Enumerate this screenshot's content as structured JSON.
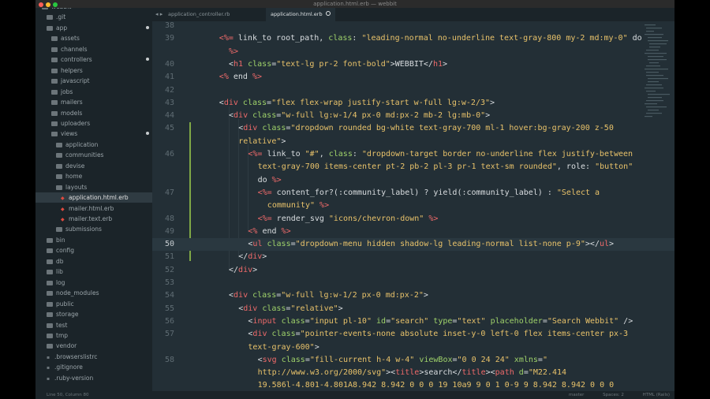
{
  "window": {
    "title": "application.html.erb — webbit"
  },
  "tabs": [
    {
      "label": "application_controller.rb",
      "active": false
    },
    {
      "label": "application.html.erb",
      "active": true
    }
  ],
  "sidebar": {
    "items": [
      {
        "label": "webbit",
        "type": "folder",
        "depth": 0
      },
      {
        "label": ".git",
        "type": "folder",
        "depth": 1
      },
      {
        "label": "app",
        "type": "folder",
        "depth": 1,
        "modified": true
      },
      {
        "label": "assets",
        "type": "folder",
        "depth": 2
      },
      {
        "label": "channels",
        "type": "folder",
        "depth": 2
      },
      {
        "label": "controllers",
        "type": "folder",
        "depth": 2,
        "modified": true
      },
      {
        "label": "helpers",
        "type": "folder",
        "depth": 2
      },
      {
        "label": "javascript",
        "type": "folder",
        "depth": 2
      },
      {
        "label": "jobs",
        "type": "folder",
        "depth": 2
      },
      {
        "label": "mailers",
        "type": "folder",
        "depth": 2
      },
      {
        "label": "models",
        "type": "folder",
        "depth": 2
      },
      {
        "label": "uploaders",
        "type": "folder",
        "depth": 2
      },
      {
        "label": "views",
        "type": "folder",
        "depth": 2,
        "modified": true
      },
      {
        "label": "application",
        "type": "folder",
        "depth": 3
      },
      {
        "label": "communities",
        "type": "folder",
        "depth": 3
      },
      {
        "label": "devise",
        "type": "folder",
        "depth": 3
      },
      {
        "label": "home",
        "type": "folder",
        "depth": 3
      },
      {
        "label": "layouts",
        "type": "folder",
        "depth": 3
      },
      {
        "label": "application.html.erb",
        "type": "file",
        "depth": 4,
        "selected": true
      },
      {
        "label": "mailer.html.erb",
        "type": "file",
        "depth": 4
      },
      {
        "label": "mailer.text.erb",
        "type": "file",
        "depth": 4
      },
      {
        "label": "submissions",
        "type": "folder",
        "depth": 3
      },
      {
        "label": "bin",
        "type": "folder",
        "depth": 1
      },
      {
        "label": "config",
        "type": "folder",
        "depth": 1
      },
      {
        "label": "db",
        "type": "folder",
        "depth": 1
      },
      {
        "label": "lib",
        "type": "folder",
        "depth": 1
      },
      {
        "label": "log",
        "type": "folder",
        "depth": 1
      },
      {
        "label": "node_modules",
        "type": "folder",
        "depth": 1
      },
      {
        "label": "public",
        "type": "folder",
        "depth": 1
      },
      {
        "label": "storage",
        "type": "folder",
        "depth": 1
      },
      {
        "label": "test",
        "type": "folder",
        "depth": 1
      },
      {
        "label": "tmp",
        "type": "folder",
        "depth": 1
      },
      {
        "label": "vendor",
        "type": "folder",
        "depth": 1
      },
      {
        "label": ".browserslistrc",
        "type": "dotfile",
        "depth": 1
      },
      {
        "label": ".gitignore",
        "type": "dotfile",
        "depth": 1
      },
      {
        "label": ".ruby-version",
        "type": "dotfile",
        "depth": 1
      }
    ]
  },
  "editor": {
    "current_line": "50",
    "lines": [
      {
        "num": "38",
        "indent": 0,
        "parts": []
      },
      {
        "num": "39",
        "indent": 4,
        "parts": [
          [
            "<%=",
            "e"
          ],
          [
            " link_to root_path, ",
            "p"
          ],
          [
            "class",
            "a"
          ],
          [
            ": ",
            "p"
          ],
          [
            "\"leading-normal no-underline text-gray-800 my-2 md:my-0\"",
            "s"
          ],
          [
            " do",
            "p"
          ]
        ]
      },
      {
        "num": "",
        "indent": 5,
        "parts": [
          [
            "%>",
            "e"
          ]
        ]
      },
      {
        "num": "40",
        "indent": 5,
        "parts": [
          [
            "<",
            "p"
          ],
          [
            "h1",
            "t"
          ],
          [
            " ",
            "p"
          ],
          [
            "class",
            "a"
          ],
          [
            "=",
            "p"
          ],
          [
            "\"text-lg pr-2 font-bold\"",
            "s"
          ],
          [
            ">WEBBIT</",
            "p"
          ],
          [
            "h1",
            "t"
          ],
          [
            ">",
            "p"
          ]
        ]
      },
      {
        "num": "41",
        "indent": 4,
        "parts": [
          [
            "<%",
            "e"
          ],
          [
            " end ",
            "p"
          ],
          [
            "%>",
            "e"
          ]
        ]
      },
      {
        "num": "42",
        "indent": 0,
        "parts": []
      },
      {
        "num": "43",
        "indent": 4,
        "parts": [
          [
            "<",
            "p"
          ],
          [
            "div",
            "t"
          ],
          [
            " ",
            "p"
          ],
          [
            "class",
            "a"
          ],
          [
            "=",
            "p"
          ],
          [
            "\"flex flex-wrap justify-start w-full lg:w-2/3\"",
            "s"
          ],
          [
            ">",
            "p"
          ]
        ]
      },
      {
        "num": "44",
        "indent": 5,
        "parts": [
          [
            "<",
            "p"
          ],
          [
            "div",
            "t"
          ],
          [
            " ",
            "p"
          ],
          [
            "class",
            "a"
          ],
          [
            "=",
            "p"
          ],
          [
            "\"w-full lg:w-1/4 px-0 md:px-2 mb-2 lg:mb-0\"",
            "s"
          ],
          [
            ">",
            "p"
          ]
        ]
      },
      {
        "num": "45",
        "indent": 6,
        "parts": [
          [
            "<",
            "p"
          ],
          [
            "div",
            "t"
          ],
          [
            " ",
            "p"
          ],
          [
            "class",
            "a"
          ],
          [
            "=",
            "p"
          ],
          [
            "\"dropdown rounded bg-white text-gray-700 ml-1 hover:bg-gray-200 z-50",
            "s"
          ]
        ]
      },
      {
        "num": "",
        "indent": 6,
        "parts": [
          [
            "relative\"",
            "s"
          ],
          [
            ">",
            "p"
          ]
        ]
      },
      {
        "num": "46",
        "indent": 7,
        "parts": [
          [
            "<%=",
            "e"
          ],
          [
            " link_to ",
            "p"
          ],
          [
            "\"#\"",
            "s"
          ],
          [
            ", ",
            "p"
          ],
          [
            "class",
            "a"
          ],
          [
            ": ",
            "p"
          ],
          [
            "\"dropdown-target border no-underline flex justify-between",
            "s"
          ]
        ]
      },
      {
        "num": "",
        "indent": 8,
        "parts": [
          [
            "text-gray-700 items-center pt-2 pb-2 pl-3 pr-1 text-sm rounded\"",
            "s"
          ],
          [
            ", role: ",
            "p"
          ],
          [
            "\"button\"",
            "s"
          ]
        ]
      },
      {
        "num": "",
        "indent": 8,
        "parts": [
          [
            "do ",
            "p"
          ],
          [
            "%>",
            "e"
          ]
        ]
      },
      {
        "num": "47",
        "indent": 8,
        "parts": [
          [
            "<%=",
            "e"
          ],
          [
            " content_for?(:community_label) ? yield(:community_label) : ",
            "p"
          ],
          [
            "\"Select a",
            "s"
          ]
        ]
      },
      {
        "num": "",
        "indent": 9,
        "parts": [
          [
            "community\"",
            "s"
          ],
          [
            " ",
            "p"
          ],
          [
            "%>",
            "e"
          ]
        ]
      },
      {
        "num": "48",
        "indent": 8,
        "parts": [
          [
            "<%=",
            "e"
          ],
          [
            " render_svg ",
            "p"
          ],
          [
            "\"icons/chevron-down\"",
            "s"
          ],
          [
            " ",
            "p"
          ],
          [
            "%>",
            "e"
          ]
        ]
      },
      {
        "num": "49",
        "indent": 7,
        "parts": [
          [
            "<%",
            "e"
          ],
          [
            " end ",
            "p"
          ],
          [
            "%>",
            "e"
          ]
        ]
      },
      {
        "num": "50",
        "indent": 7,
        "parts": [
          [
            "<",
            "p"
          ],
          [
            "ul",
            "t"
          ],
          [
            " ",
            "p"
          ],
          [
            "class",
            "a"
          ],
          [
            "=",
            "p"
          ],
          [
            "\"dropdown-menu hidden shadow-lg leading-normal list-none p-9\"",
            "s"
          ],
          [
            "></",
            "p"
          ],
          [
            "ul",
            "t"
          ],
          [
            ">",
            "p"
          ]
        ]
      },
      {
        "num": "51",
        "indent": 6,
        "parts": [
          [
            "</",
            "p"
          ],
          [
            "div",
            "t"
          ],
          [
            ">",
            "p"
          ]
        ]
      },
      {
        "num": "52",
        "indent": 5,
        "parts": [
          [
            "</",
            "p"
          ],
          [
            "div",
            "t"
          ],
          [
            ">",
            "p"
          ]
        ]
      },
      {
        "num": "53",
        "indent": 0,
        "parts": []
      },
      {
        "num": "54",
        "indent": 5,
        "parts": [
          [
            "<",
            "p"
          ],
          [
            "div",
            "t"
          ],
          [
            " ",
            "p"
          ],
          [
            "class",
            "a"
          ],
          [
            "=",
            "p"
          ],
          [
            "\"w-full lg:w-1/2 px-0 md:px-2\"",
            "s"
          ],
          [
            ">",
            "p"
          ]
        ]
      },
      {
        "num": "55",
        "indent": 6,
        "parts": [
          [
            "<",
            "p"
          ],
          [
            "div",
            "t"
          ],
          [
            " ",
            "p"
          ],
          [
            "class",
            "a"
          ],
          [
            "=",
            "p"
          ],
          [
            "\"relative\"",
            "s"
          ],
          [
            ">",
            "p"
          ]
        ]
      },
      {
        "num": "56",
        "indent": 7,
        "parts": [
          [
            "<",
            "p"
          ],
          [
            "input",
            "t"
          ],
          [
            " ",
            "p"
          ],
          [
            "class",
            "a"
          ],
          [
            "=",
            "p"
          ],
          [
            "\"input pl-10\"",
            "s"
          ],
          [
            " ",
            "p"
          ],
          [
            "id",
            "a"
          ],
          [
            "=",
            "p"
          ],
          [
            "\"search\"",
            "s"
          ],
          [
            " ",
            "p"
          ],
          [
            "type",
            "a"
          ],
          [
            "=",
            "p"
          ],
          [
            "\"text\"",
            "s"
          ],
          [
            " ",
            "p"
          ],
          [
            "placeholder",
            "a"
          ],
          [
            "=",
            "p"
          ],
          [
            "\"Search Webbit\"",
            "s"
          ],
          [
            " />",
            "p"
          ]
        ]
      },
      {
        "num": "57",
        "indent": 7,
        "parts": [
          [
            "<",
            "p"
          ],
          [
            "div",
            "t"
          ],
          [
            " ",
            "p"
          ],
          [
            "class",
            "a"
          ],
          [
            "=",
            "p"
          ],
          [
            "\"pointer-events-none absolute inset-y-0 left-0 flex items-center px-3",
            "s"
          ]
        ]
      },
      {
        "num": "",
        "indent": 7,
        "parts": [
          [
            "text-gray-600\"",
            "s"
          ],
          [
            ">",
            "p"
          ]
        ]
      },
      {
        "num": "58",
        "indent": 8,
        "parts": [
          [
            "<",
            "p"
          ],
          [
            "svg",
            "t"
          ],
          [
            " ",
            "p"
          ],
          [
            "class",
            "a"
          ],
          [
            "=",
            "p"
          ],
          [
            "\"fill-current h-4 w-4\"",
            "s"
          ],
          [
            " ",
            "p"
          ],
          [
            "viewBox",
            "a"
          ],
          [
            "=",
            "p"
          ],
          [
            "\"0 0 24 24\"",
            "s"
          ],
          [
            " ",
            "p"
          ],
          [
            "xmlns",
            "a"
          ],
          [
            "=",
            "p"
          ],
          [
            "\"",
            "s"
          ]
        ]
      },
      {
        "num": "",
        "indent": 8,
        "parts": [
          [
            "http://www.w3.org/2000/svg\"",
            "s"
          ],
          [
            "><",
            "p"
          ],
          [
            "title",
            "t"
          ],
          [
            ">search</",
            "p"
          ],
          [
            "title",
            "t"
          ],
          [
            "><",
            "p"
          ],
          [
            "path",
            "t"
          ],
          [
            " ",
            "p"
          ],
          [
            "d",
            "a"
          ],
          [
            "=",
            "p"
          ],
          [
            "\"M22.414",
            "s"
          ]
        ]
      },
      {
        "num": "",
        "indent": 8,
        "parts": [
          [
            "19.586l-4.801-4.801A8.942 8.942 0 0 0 19 10a9 9 0 1 0-9 9 8.942 8.942 0 0 0",
            "s"
          ]
        ]
      }
    ]
  },
  "status": {
    "position": "Line 50, Column 80",
    "branch": "master",
    "indent": "Spaces: 2",
    "syntax": "HTML (Rails)"
  }
}
